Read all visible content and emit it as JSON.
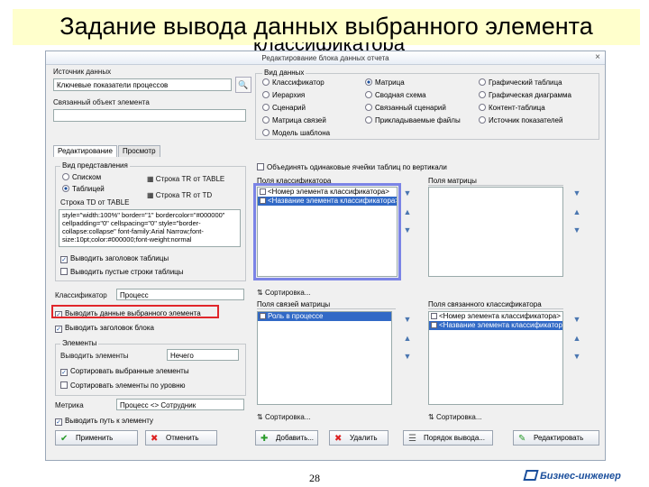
{
  "slide": {
    "title": "Задание вывода данных выбранного элемента",
    "title_tail": "классификатора",
    "page_number": "28",
    "logo_text": "Бизнес-инженер"
  },
  "dialog": {
    "title": "Редактирование блока данных отчета",
    "close": "×",
    "source_label": "Источник данных",
    "source_value": "Ключевые показатели процессов",
    "extra_label": "Связанный объект элемента",
    "extra_value": "",
    "view_group": "Вид данных",
    "view_options": [
      {
        "label": "Классификатор",
        "on": false
      },
      {
        "label": "Матрица",
        "on": true
      },
      {
        "label": "Графический таблица",
        "on": false
      },
      {
        "label": "Иерархия",
        "on": false
      },
      {
        "label": "Сводная схема",
        "on": false
      },
      {
        "label": "Графическая диаграмма",
        "on": false
      },
      {
        "label": "Сценарий",
        "on": false
      },
      {
        "label": "Связанный сценарий",
        "on": false
      },
      {
        "label": "Контент-таблица",
        "on": false
      },
      {
        "label": "Матрица связей",
        "on": false
      },
      {
        "label": "Прикладываемые файлы",
        "on": false
      },
      {
        "label": "Источник показателей",
        "on": false
      },
      {
        "label": "Модель шаблона",
        "on": false
      }
    ],
    "tabs": [
      "Редактирование",
      "Просмотр"
    ],
    "output_group": "Вид представления",
    "out_options": [
      {
        "label": "Списком",
        "on": false
      },
      {
        "label": "Таблицей",
        "on": true
      }
    ],
    "table_btn_top": "Строка TR от TABLE",
    "table_btn_bottom": "Строка TR от TD",
    "style_label": "Строка TD от TABLE",
    "style_text": "style=\"width:100%\" border=\"1\" bordercolor=\"#000000\" cellpadding=\"0\" cellspacing=\"0\" style=\"border-collapse:collapse\" font-family:Arial Narrow;font-size:10pt;color:#000000;font-weight:normal",
    "check_header": "Выводить заголовок таблицы",
    "check_empty": "Выводить пустые строки таблицы",
    "classifier_label": "Классификатор",
    "classifier_value": "Процесс",
    "check_selected": "Выводить данные выбранного элемента",
    "check_title": "Выводить заголовок блока",
    "elements_group": "Элементы",
    "output_label": "Выводить элементы",
    "output_value": "Нечего",
    "check_sort": "Сортировать выбранные элементы",
    "check_level": "Сортировать элементы по уровню",
    "metric_label": "Метрика",
    "metric_value": "Процесс <> Сотрудник",
    "check_path": "Выводить путь к элементу",
    "check_merge": "Объединять одинаковые ячейки таблиц по вертикали",
    "fields_classifier_head": "Поля классификатора",
    "fields_matrix_head": "Поля матрицы",
    "classifier_fields": [
      {
        "label": "<Номер элемента классификатора>",
        "sel": false
      },
      {
        "label": "<Название элемента классификатора>",
        "sel": true
      }
    ],
    "sort_label_1": "Сортировка...",
    "link_matrix_head": "Поля связей матрицы",
    "link_classifier_head": "Поля связанного классификатора",
    "link_matrix_fields": [
      {
        "label": "Роль в процессе",
        "sel": true
      }
    ],
    "link_classifier_fields": [
      {
        "label": "<Номер элемента классификатора>",
        "sel": false
      },
      {
        "label": "<Название элемента классификатора>",
        "sel": true
      }
    ],
    "sort_label_2": "Сортировка...",
    "sort_label_3": "Сортировка...",
    "buttons": {
      "apply": "Применить",
      "cancel": "Отменить",
      "add": "Добавить...",
      "delete": "Удалить",
      "order": "Порядок вывода...",
      "edit": "Редактировать"
    },
    "colors": {
      "highlight": "#e0262b",
      "selection": "#3169c6",
      "frame": "#7b84e6"
    }
  }
}
